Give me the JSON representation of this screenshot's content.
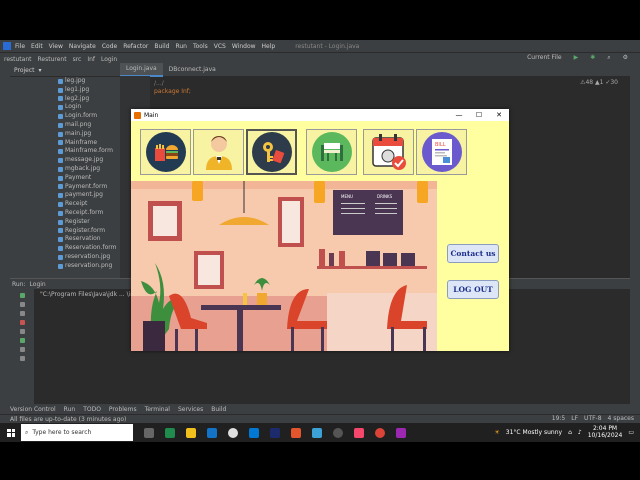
{
  "ide": {
    "menu": [
      "File",
      "Edit",
      "View",
      "Navigate",
      "Code",
      "Refactor",
      "Build",
      "Run",
      "Tools",
      "VCS",
      "Window",
      "Help"
    ],
    "window_title": "restutant - Login.java",
    "breadcrumb": [
      "restutant",
      "Resturent",
      "src",
      "Inf",
      "Login"
    ],
    "run_config": "Current File",
    "project_label": "Project",
    "editor_tabs": [
      "Login.java",
      "DBconnect.java"
    ],
    "code_fold": "/.../",
    "code_line": "package Inf;",
    "inspections": "⚠48  ▲1  ✓30",
    "files": [
      "leg.jpg",
      "leg1.jpg",
      "leg2.jpg",
      "Login",
      "Login.form",
      "mail.png",
      "main.jpg",
      "Mainframe",
      "Mainframe.form",
      "message.jpg",
      "mgback.jpg",
      "Payment",
      "Payment.form",
      "payment.jpg",
      "Receipt",
      "Receipt.form",
      "Register",
      "Register.form",
      "Reservation",
      "Reservation.form",
      "reservation.jpg",
      "reservation.png"
    ],
    "run_tabs": [
      "Run:",
      "Login"
    ],
    "run_output": "\"C:\\Program Files\\Java\\jdk ... \\intelj\\IntelliJ IDEA Community E",
    "bottom_tools": [
      "Version Control",
      "Run",
      "TODO",
      "Problems",
      "Terminal",
      "Services",
      "Build"
    ],
    "status_text": "All files are up-to-date (3 minutes ago)",
    "status_right": [
      "19:5",
      "LF",
      "UTF-8",
      "4 spaces"
    ]
  },
  "taskbar": {
    "search_placeholder": "Type here to search",
    "weather": "31°C  Mostly sunny",
    "time": "2:04 PM",
    "date": "10/16/2024"
  },
  "main_window": {
    "title": "Main",
    "icons": [
      "food-icon",
      "waiter-icon",
      "key-icon",
      "table-icon",
      "reservation-icon",
      "bill-icon"
    ],
    "bill_label": "BILL",
    "menu_board": {
      "left": "MENU",
      "right": "DRINKS"
    },
    "contact_label": "Contact us",
    "logout_label": "LOG OUT"
  }
}
